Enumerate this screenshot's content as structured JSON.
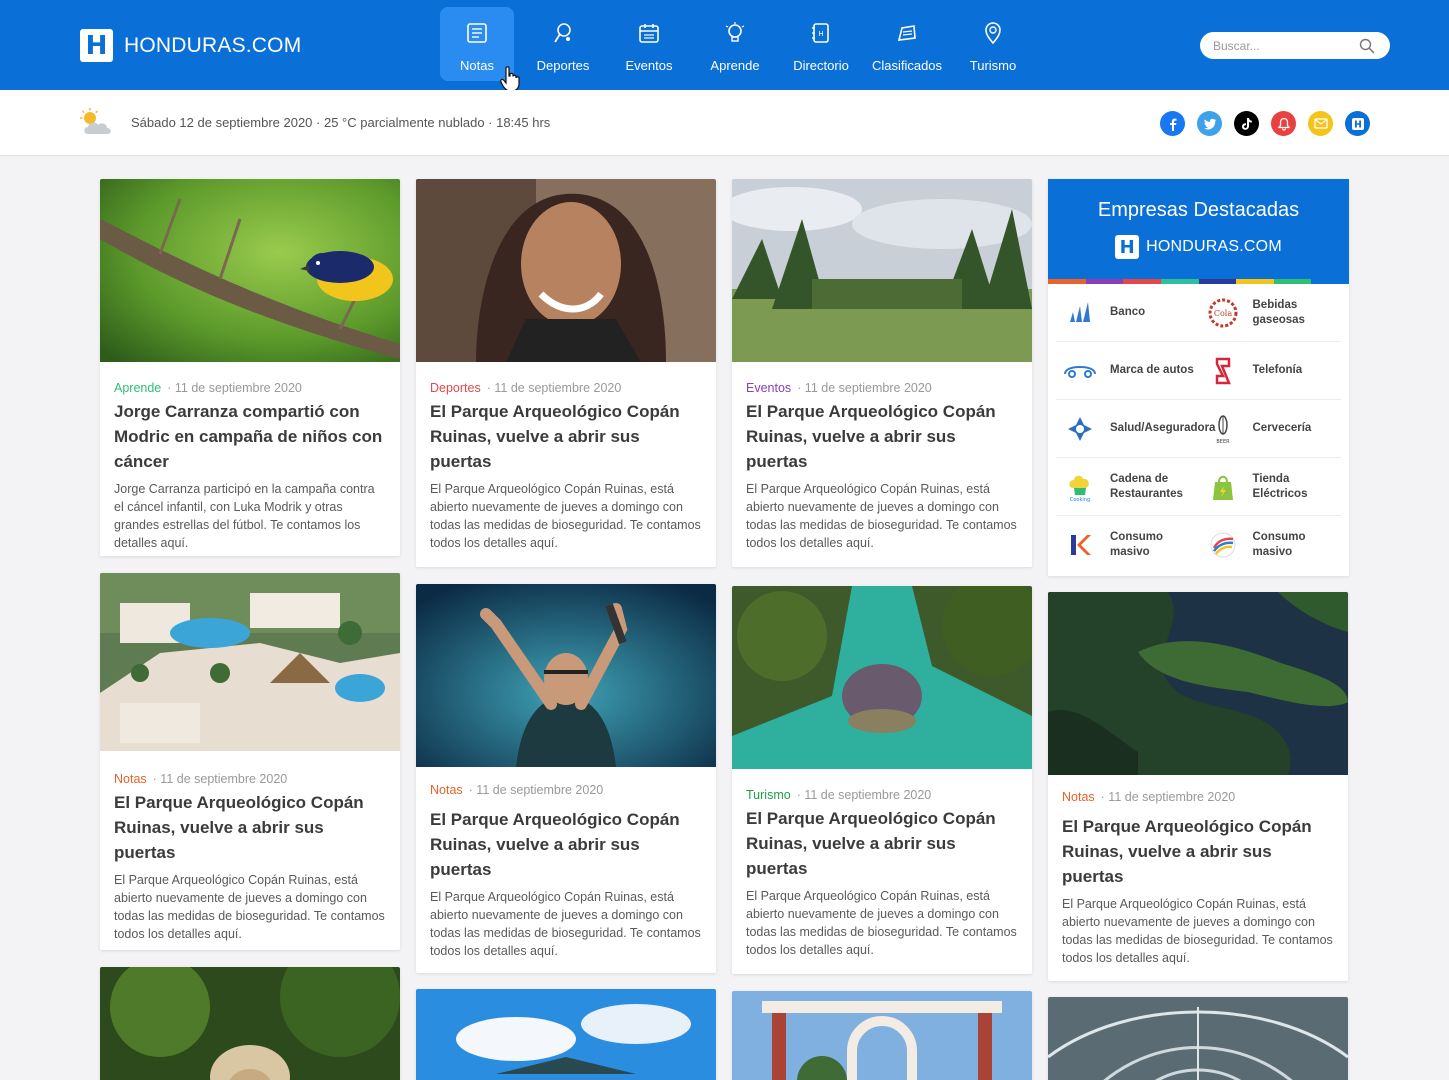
{
  "header": {
    "logo_text": "HONDURAS.COM",
    "logo_letter": "H",
    "nav": [
      {
        "label": "Notas",
        "icon": "notes-icon"
      },
      {
        "label": "Deportes",
        "icon": "sports-icon"
      },
      {
        "label": "Eventos",
        "icon": "calendar-icon"
      },
      {
        "label": "Aprende",
        "icon": "lightbulb-icon"
      },
      {
        "label": "Directorio",
        "icon": "directory-icon"
      },
      {
        "label": "Clasificados",
        "icon": "classifieds-icon"
      },
      {
        "label": "Turismo",
        "icon": "map-pin-icon"
      }
    ],
    "search_placeholder": "Buscar..."
  },
  "infobar": {
    "date_text": "Sábado 12 de septiembre 2020 · 25 °C parcialmente nublado · 18:45 hrs",
    "socials": [
      {
        "name": "facebook-icon",
        "glyph": "f",
        "color": "#1877f2"
      },
      {
        "name": "twitter-icon",
        "glyph": "t",
        "color": "#3ea2ea"
      },
      {
        "name": "tiktok-icon",
        "glyph": "♪",
        "color": "#000000"
      },
      {
        "name": "notification-icon",
        "glyph": "🔔",
        "color": "#e8413f"
      },
      {
        "name": "mail-icon",
        "glyph": "✉",
        "color": "#f3c41a"
      },
      {
        "name": "honduras-icon",
        "glyph": "H",
        "color": "#0a6fd6"
      }
    ]
  },
  "colors": {
    "brand_blue": "#0a6fd6",
    "cat_aprende": "#2fbf74",
    "cat_deportes": "#e2474a",
    "cat_eventos": "#8a3fb3",
    "cat_notas": "#e8622b",
    "cat_turismo": "#20a04a"
  },
  "cards": [
    {
      "category": "Aprende",
      "date": "· 11 de septiembre 2020",
      "title": "Jorge Carranza compartió con Modric en campaña de niños con cáncer",
      "text": "Jorge Carranza participó en la campaña contra el cáncel infantil, con Luka Modrik y otras grandes estrellas del fútbol. Te contamos los detalles aquí."
    },
    {
      "category": "Deportes",
      "date": "· 11 de septiembre 2020",
      "title": "El Parque Arqueológico Copán Ruinas, vuelve a abrir sus puertas",
      "text": "El Parque Arqueológico Copán Ruinas, está abierto nuevamente de jueves a domingo con todas las medidas de bioseguridad. Te contamos todos los detalles aquí."
    },
    {
      "category": "Eventos",
      "date": "· 11 de septiembre 2020",
      "title": "El Parque Arqueológico Copán Ruinas, vuelve a abrir sus puertas",
      "text": "El Parque Arqueológico Copán Ruinas, está abierto nuevamente de jueves a domingo con todas las medidas de bioseguridad. Te contamos todos los detalles aquí."
    },
    {
      "category": "Notas",
      "date": "· 11 de septiembre 2020",
      "title": "El Parque Arqueológico Copán Ruinas, vuelve a abrir sus puertas",
      "text": "El Parque Arqueológico Copán Ruinas, está abierto nuevamente de jueves a domingo con todas las medidas de bioseguridad. Te contamos todos los detalles aquí."
    },
    {
      "category": "Notas",
      "date": "· 11 de septiembre 2020",
      "title": "El Parque Arqueológico Copán Ruinas, vuelve a abrir sus puertas",
      "text": "El Parque Arqueológico Copán Ruinas, está abierto nuevamente de jueves a domingo con todas las medidas de bioseguridad. Te contamos todos los detalles aquí."
    },
    {
      "category": "Turismo",
      "date": "· 11 de septiembre 2020",
      "title": "El Parque Arqueológico Copán Ruinas, vuelve a abrir sus puertas",
      "text": "El Parque Arqueológico Copán Ruinas, está abierto nuevamente de jueves a domingo con todas las medidas de bioseguridad. Te contamos todos los detalles aquí."
    },
    {
      "category": "Notas",
      "date": "· 11 de septiembre 2020",
      "title": "El Parque Arqueológico Copán Ruinas, vuelve a abrir sus puertas",
      "text": "El Parque Arqueológico Copán Ruinas, está abierto nuevamente de jueves a domingo con todas las medidas de bioseguridad. Te contamos todos los detalles aquí."
    }
  ],
  "sidebar": {
    "title": "Empresas Destacadas",
    "logo_text": "HONDURAS.COM",
    "logo_letter": "H",
    "brands": [
      {
        "label": "Banco",
        "icon": "bank-logo-icon"
      },
      {
        "label": "Bebidas gaseosas",
        "icon": "soda-logo-icon"
      },
      {
        "label": "Marca de autos",
        "icon": "car-brand-logo-icon"
      },
      {
        "label": "Telefonía",
        "icon": "telecom-logo-icon"
      },
      {
        "label": "Salud/Aseguradora",
        "icon": "health-insurance-logo-icon"
      },
      {
        "label": "Cervecería",
        "icon": "brewery-logo-icon"
      },
      {
        "label": "Cadena de Restaurantes",
        "icon": "restaurant-chain-logo-icon"
      },
      {
        "label": "Tienda Eléctricos",
        "icon": "electronics-store-logo-icon"
      },
      {
        "label": "Consumo masivo",
        "icon": "consumer-goods-logo-icon"
      },
      {
        "label": "Consumo masivo",
        "icon": "consumer-goods-logo-icon-2"
      }
    ]
  }
}
